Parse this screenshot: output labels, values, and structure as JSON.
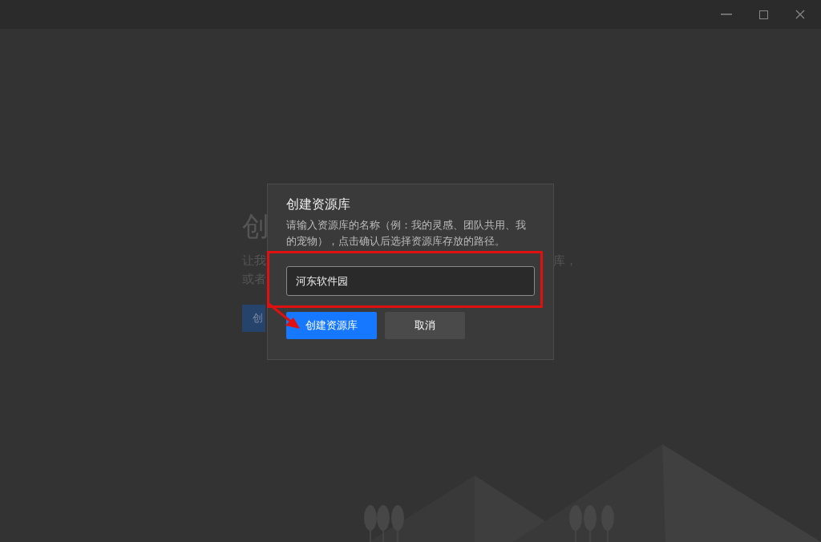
{
  "backdrop": {
    "heading": "创",
    "description_line_1_start": "让我",
    "description_line_1_end": "库，",
    "description_line_2": "或者",
    "button": "创"
  },
  "dialog": {
    "title": "创建资源库",
    "description": "请输入资源库的名称（例：我的灵感、团队共用、我的宠物），点击确认后选择资源库存放的路径。",
    "name_field": {
      "value": "河东软件园"
    },
    "buttons": [
      {
        "label": "创建资源库",
        "kind": "primary"
      },
      {
        "label": "取消",
        "kind": "secondary"
      }
    ]
  },
  "annotation": {
    "highlight": true,
    "arrow": true
  }
}
